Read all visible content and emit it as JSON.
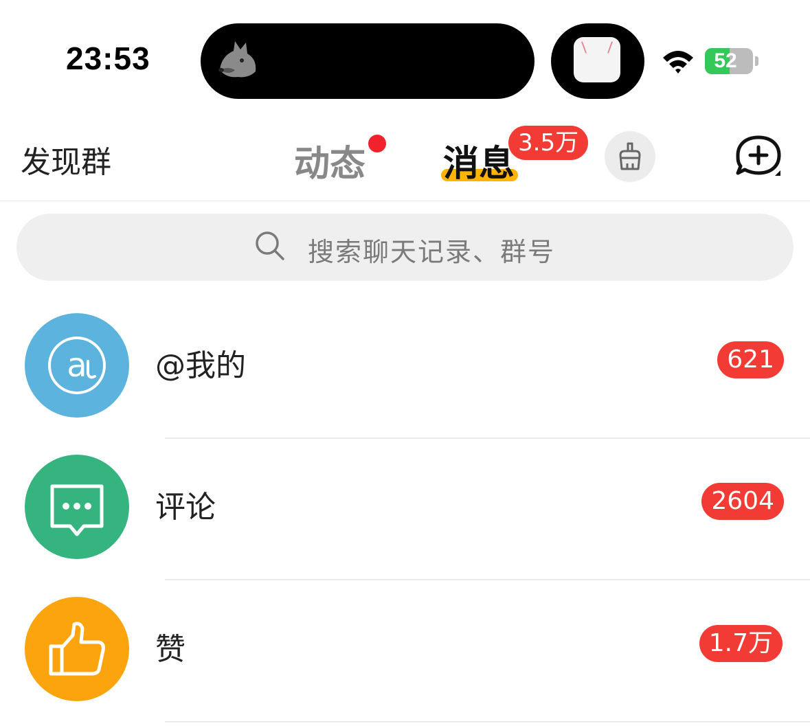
{
  "status_bar": {
    "time": "23:53",
    "battery": "52",
    "battery_level": 0.52
  },
  "header": {
    "discover_groups": "发现群",
    "tab_dynamic": "动态",
    "tab_messages": "消息",
    "messages_badge": "3.5万"
  },
  "search": {
    "placeholder": "搜索聊天记录、群号"
  },
  "list": [
    {
      "label": "@我的",
      "badge": "621",
      "icon": "at-icon",
      "color": "#5bb3de"
    },
    {
      "label": "评论",
      "badge": "2604",
      "icon": "comment-icon",
      "color": "#35b47f"
    },
    {
      "label": "赞",
      "badge": "1.7万",
      "icon": "thumbs-up-icon",
      "color": "#fba40d"
    }
  ],
  "colors": {
    "badge_red": "#f23b34",
    "tab_underline": "#ffb400"
  }
}
